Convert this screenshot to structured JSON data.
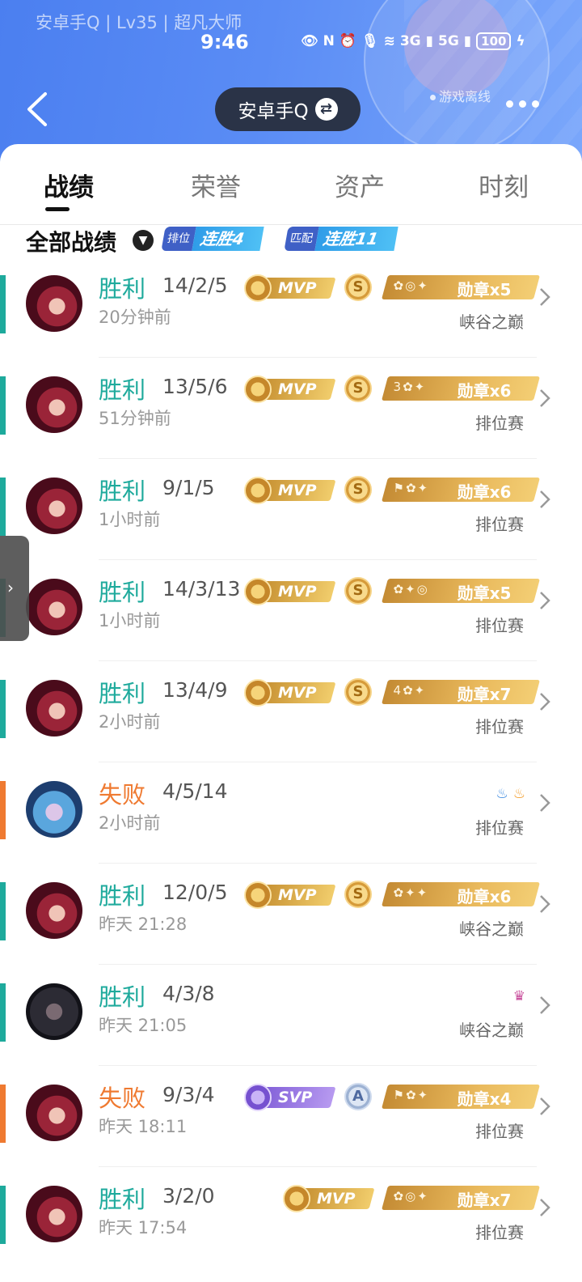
{
  "status_bar": {
    "profile_line": "安卓手Q | Lv35 | 超凡大师",
    "clock": "9:46",
    "net_3g": "3G",
    "net_5g": "5G",
    "battery": "100"
  },
  "header": {
    "account_name": "安卓手Q",
    "online_status": "游戏离线"
  },
  "tabs": [
    "战绩",
    "荣誉",
    "资产",
    "时刻"
  ],
  "active_tab": "战绩",
  "filter": {
    "title": "全部战绩",
    "ranked_label": "排位",
    "ranked_streak": "连胜4",
    "match_label": "匹配",
    "match_streak": "连胜11"
  },
  "matches": [
    {
      "result": "胜利",
      "outcome": "win",
      "kda": "14/2/5",
      "time": "20分钟前",
      "mode": "峡谷之巅",
      "perf": "MVP",
      "grade": "S",
      "medal_text": "勋章x5",
      "avatar": "red"
    },
    {
      "result": "胜利",
      "outcome": "win",
      "kda": "13/5/6",
      "time": "51分钟前",
      "mode": "排位赛",
      "perf": "MVP",
      "grade": "S",
      "medal_text": "勋章x6",
      "avatar": "red"
    },
    {
      "result": "胜利",
      "outcome": "win",
      "kda": "9/1/5",
      "time": "1小时前",
      "mode": "排位赛",
      "perf": "MVP",
      "grade": "S",
      "medal_text": "勋章x6",
      "avatar": "red"
    },
    {
      "result": "胜利",
      "outcome": "win",
      "kda": "14/3/13",
      "time": "1小时前",
      "mode": "排位赛",
      "perf": "MVP",
      "grade": "S",
      "medal_text": "勋章x5",
      "avatar": "red"
    },
    {
      "result": "胜利",
      "outcome": "win",
      "kda": "13/4/9",
      "time": "2小时前",
      "mode": "排位赛",
      "perf": "MVP",
      "grade": "S",
      "medal_text": "勋章x7",
      "avatar": "red"
    },
    {
      "result": "失败",
      "outcome": "loss",
      "kda": "4/5/14",
      "time": "2小时前",
      "mode": "排位赛",
      "perf": "",
      "grade": "",
      "medal_text": "",
      "avatar": "blue"
    },
    {
      "result": "胜利",
      "outcome": "win",
      "kda": "12/0/5",
      "time": "昨天 21:28",
      "mode": "峡谷之巅",
      "perf": "MVP",
      "grade": "S",
      "medal_text": "勋章x6",
      "avatar": "red"
    },
    {
      "result": "胜利",
      "outcome": "win",
      "kda": "4/3/8",
      "time": "昨天 21:05",
      "mode": "峡谷之巅",
      "perf": "",
      "grade": "",
      "medal_text": "",
      "avatar": "dark"
    },
    {
      "result": "失败",
      "outcome": "loss",
      "kda": "9/3/4",
      "time": "昨天 18:11",
      "mode": "排位赛",
      "perf": "SVP",
      "grade": "A",
      "medal_text": "勋章x4",
      "avatar": "red"
    },
    {
      "result": "胜利",
      "outcome": "win",
      "kda": "3/2/0",
      "time": "昨天 17:54",
      "mode": "排位赛",
      "perf": "MVP",
      "grade": "",
      "medal_text": "勋章x7",
      "avatar": "red"
    }
  ],
  "colors": {
    "win": "#1eaa9c",
    "loss": "#ef7a31",
    "header_blue": "#4b7ff0"
  }
}
